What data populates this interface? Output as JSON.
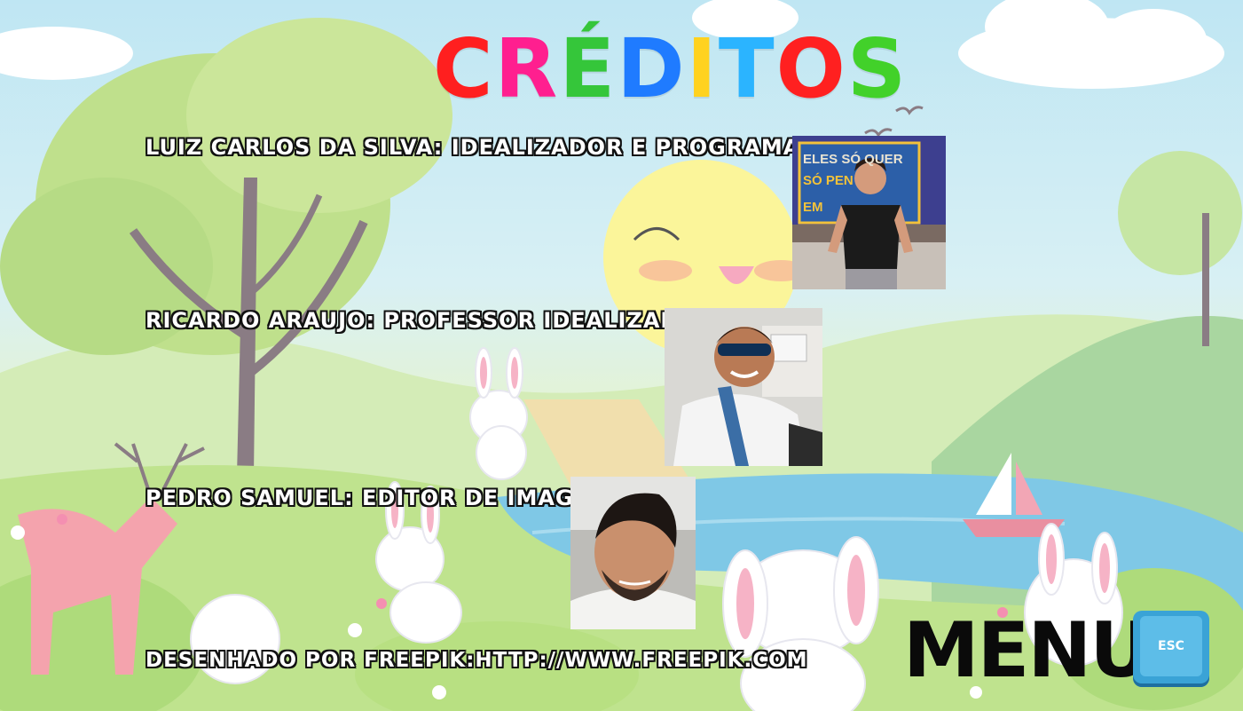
{
  "title": {
    "letters": [
      "C",
      "R",
      "É",
      "D",
      "I",
      "T",
      "O",
      "S"
    ],
    "colors": [
      "#ff1f1f",
      "#ff1f8f",
      "#35c63a",
      "#1f7bff",
      "#ffd21f",
      "#2bb4ff",
      "#ff2020",
      "#42d12a"
    ]
  },
  "credits": [
    {
      "text": "Luiz Carlos da Silva: Idealizador e Programador"
    },
    {
      "text": "Ricardo Araujo: Professor Idealizador"
    },
    {
      "text": "Pedro Samuel: Editor de Imagens"
    }
  ],
  "poster_text": [
    "ELES SÓ QUER",
    "SÓ PEN",
    "EM"
  ],
  "footer": {
    "attribution": "Desenhado por Freepik:http://www.freepik.com"
  },
  "menu": {
    "label": "MENU",
    "key": "ESC"
  },
  "colors": {
    "sky": "#bfe6f3",
    "grass": "#c9e7a6",
    "lake": "#7fc8e6",
    "sun": "#fbf59a",
    "esc_key": "#3aa3d6"
  }
}
